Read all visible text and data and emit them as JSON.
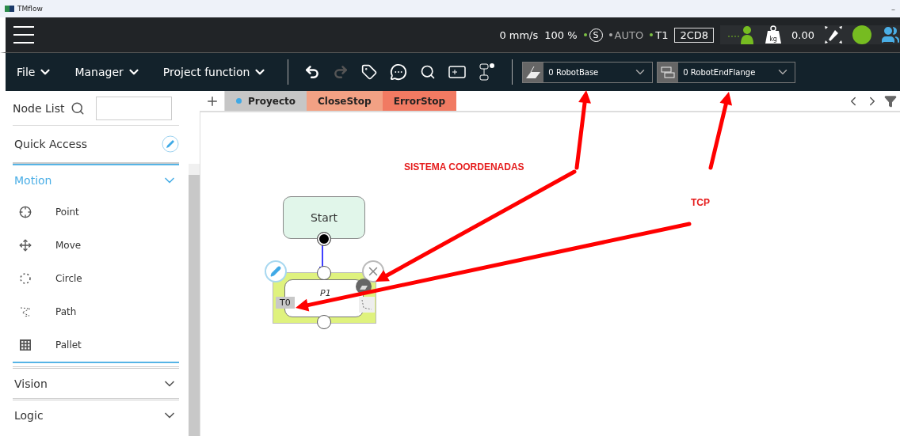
{
  "window": {
    "title": "TMflow",
    "minimize": "–"
  },
  "status": {
    "speed": "0 mm/s",
    "percent": "100 %",
    "indicators": [
      {
        "label": "S",
        "kind": "circled",
        "active": true
      },
      {
        "label": "AUTO",
        "kind": "plain",
        "active": false
      },
      {
        "label": "T1",
        "kind": "plain",
        "active": true
      }
    ],
    "code": "2CD8",
    "weight_unit": "kg",
    "payload": "0.00"
  },
  "menus": [
    {
      "label": "File"
    },
    {
      "label": "Manager"
    },
    {
      "label": "Project function"
    }
  ],
  "selectors": [
    {
      "kind": "base",
      "value": "0 RobotBase"
    },
    {
      "kind": "tool",
      "value": "0 RobotEndFlange"
    }
  ],
  "sidebar": {
    "title": "Node List",
    "quick_access": "Quick Access",
    "categories": [
      {
        "label": "Motion",
        "expanded": true,
        "items": [
          {
            "label": "Point",
            "kind": "point"
          },
          {
            "label": "Move",
            "kind": "move"
          },
          {
            "label": "Circle",
            "kind": "circle"
          },
          {
            "label": "Path",
            "kind": "path"
          },
          {
            "label": "Pallet",
            "kind": "pallet"
          }
        ]
      },
      {
        "label": "Vision",
        "expanded": false
      },
      {
        "label": "Logic",
        "expanded": false
      }
    ]
  },
  "tabs": [
    {
      "label": "Proyecto",
      "selected": true,
      "color": "#c6c6c6"
    },
    {
      "label": "CloseStop",
      "selected": false,
      "color": "#f2a184"
    },
    {
      "label": "ErrorStop",
      "selected": false,
      "color": "#f17a62"
    }
  ],
  "flow": {
    "start": "Start",
    "node": {
      "label": "P1",
      "tool": "T0"
    }
  },
  "annotations": [
    {
      "text": "SISTEMA COORDENADAS",
      "kind": "coords"
    },
    {
      "text": "TCP",
      "kind": "tcp"
    }
  ]
}
